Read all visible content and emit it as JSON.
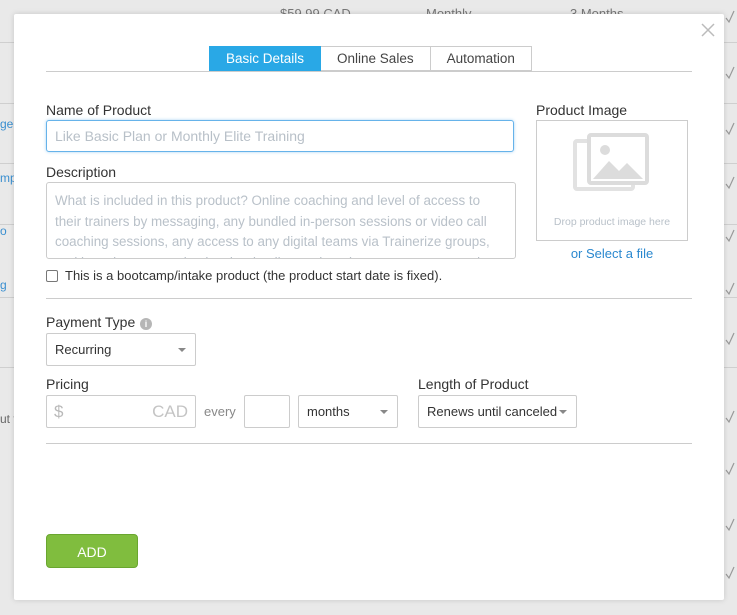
{
  "background": {
    "price_text": "$59.99 CAD",
    "frequency_text": "Monthly",
    "duration_text": "3 Months",
    "left_link_fragments": [
      "ge",
      "mp",
      "o",
      "g",
      "ut t"
    ]
  },
  "modal": {
    "close_label": "×",
    "tabs": [
      {
        "label": "Basic Details",
        "active": true
      },
      {
        "label": "Online Sales",
        "active": false
      },
      {
        "label": "Automation",
        "active": false
      }
    ],
    "name": {
      "label": "Name of Product",
      "placeholder": "Like Basic Plan or Monthly Elite Training",
      "value": ""
    },
    "description": {
      "label": "Description",
      "placeholder": "What is included in this product? Online coaching and level of access to their trainers by messaging, any bundled in-person sessions or video call coaching sessions, any access to any digital teams via Trainerize groups, and how they access it, plus the details on when the program starts and what will happen."
    },
    "product_image": {
      "label": "Product Image",
      "drop_text": "Drop product image here",
      "select_link": "or Select a file"
    },
    "bootcamp_checkbox": {
      "label": "This is a bootcamp/intake product (the product start date is fixed).",
      "checked": false
    },
    "payment_type": {
      "label": "Payment Type",
      "info_icon_glyph": "i",
      "selected": "Recurring"
    },
    "pricing": {
      "label": "Pricing",
      "currency_symbol": "$",
      "currency_code": "CAD",
      "every_label": "every",
      "interval_value": "",
      "interval_unit": "months"
    },
    "length": {
      "label": "Length of Product",
      "selected": "Renews until canceled"
    },
    "add_button_label": "ADD"
  },
  "colors": {
    "tab_active": "#29a8e6",
    "add_button": "#80bd3e",
    "link": "#2a88cf"
  }
}
